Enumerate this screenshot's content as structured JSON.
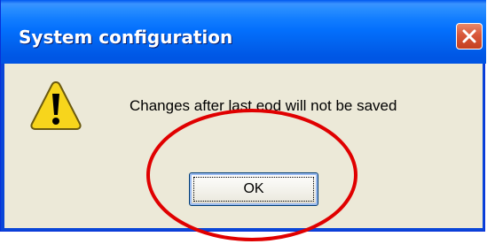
{
  "dialog": {
    "title": "System configuration",
    "message": "Changes after last eod will not be saved",
    "ok_label": "OK"
  },
  "icons": {
    "message_icon": "warning-icon",
    "close_icon": "close-icon"
  },
  "colors": {
    "title_bar": "#0054e3",
    "client_background": "#ece9d8",
    "close_button": "#d8573a",
    "annotation_circle": "#e00000"
  }
}
